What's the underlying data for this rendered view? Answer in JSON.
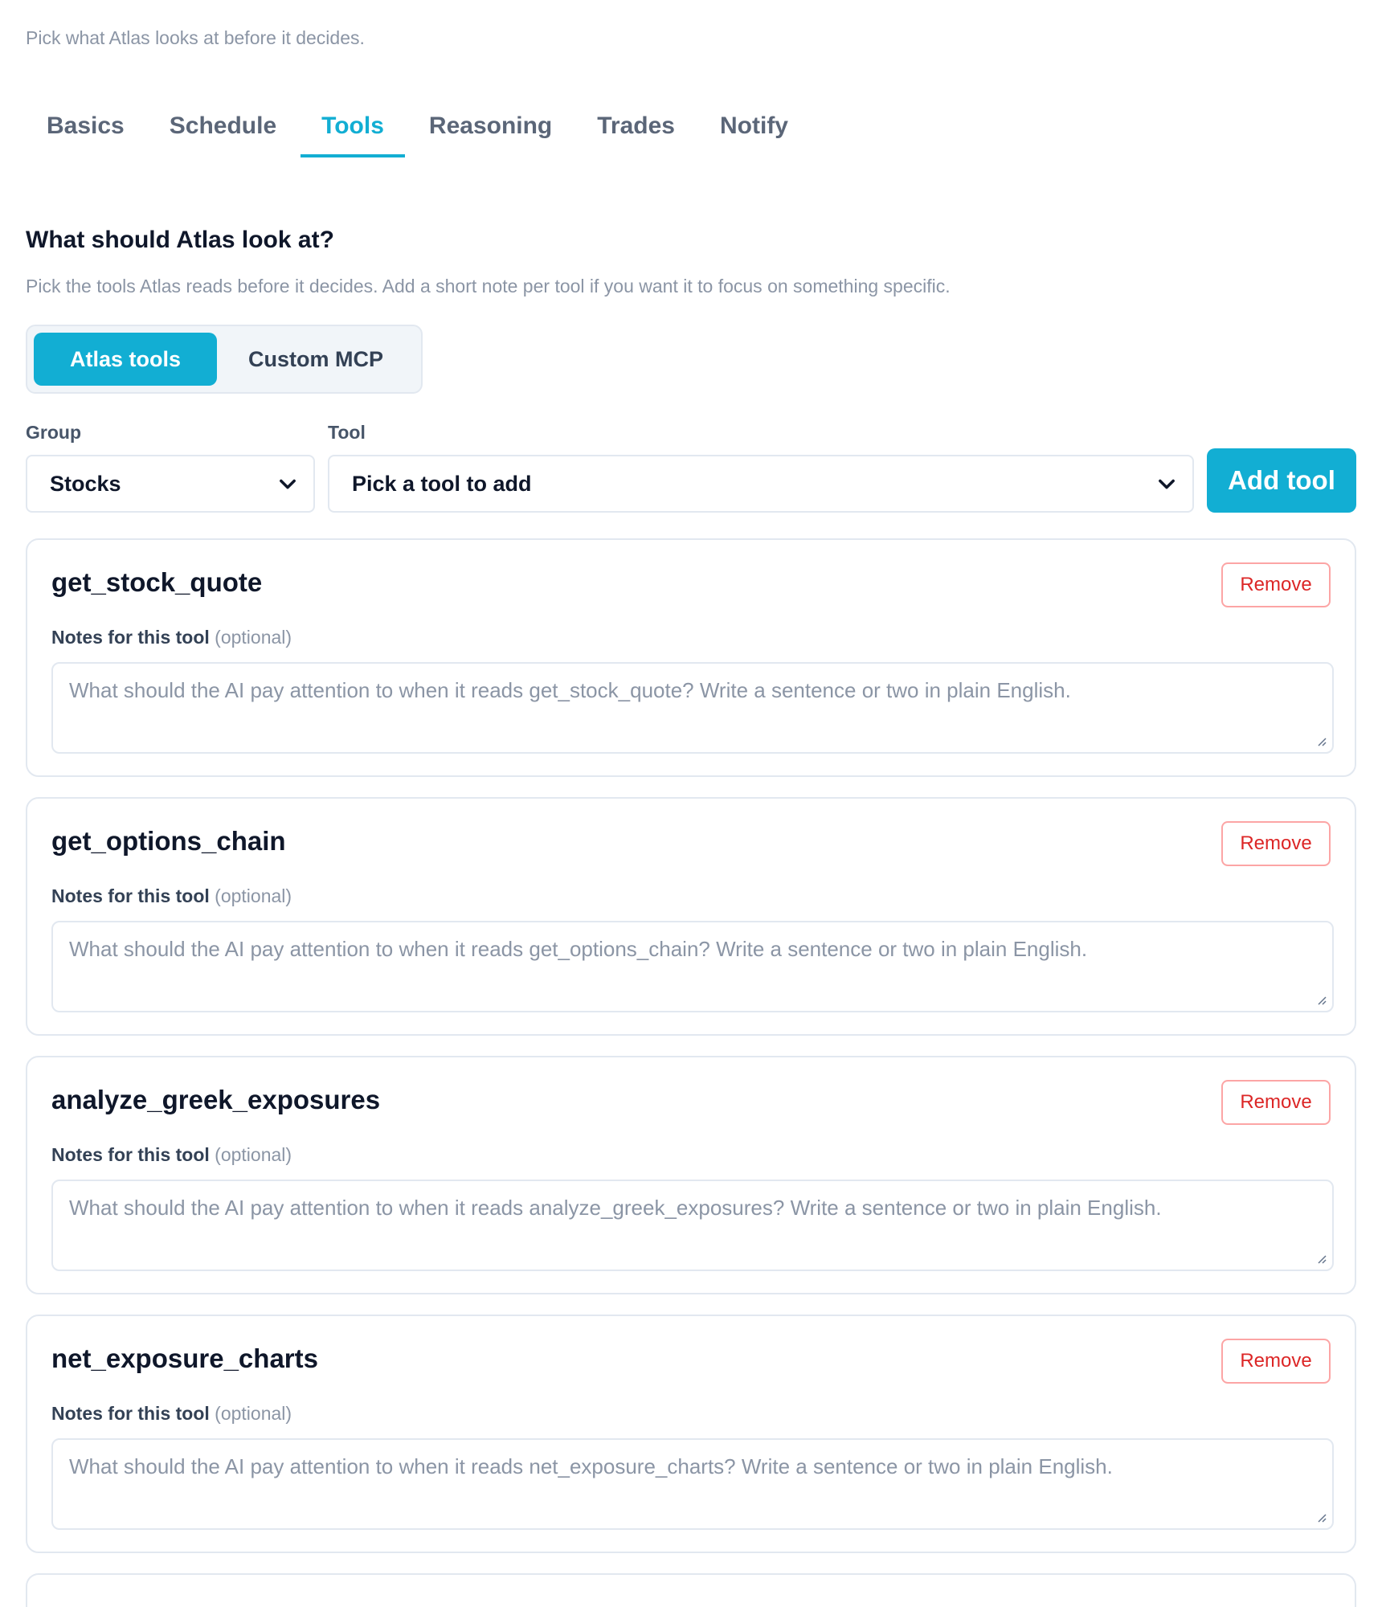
{
  "header": {
    "subtitle": "Pick what Atlas looks at before it decides."
  },
  "tabs": [
    {
      "label": "Basics",
      "active": false
    },
    {
      "label": "Schedule",
      "active": false
    },
    {
      "label": "Tools",
      "active": true
    },
    {
      "label": "Reasoning",
      "active": false
    },
    {
      "label": "Trades",
      "active": false
    },
    {
      "label": "Notify",
      "active": false
    }
  ],
  "section": {
    "title": "What should Atlas look at?",
    "description": "Pick the tools Atlas reads before it decides. Add a short note per tool if you want it to focus on something specific."
  },
  "source_toggle": {
    "options": [
      "Atlas tools",
      "Custom MCP"
    ],
    "selected": "Atlas tools"
  },
  "picker": {
    "group_label": "Group",
    "group_value": "Stocks",
    "tool_label": "Tool",
    "tool_value": "Pick a tool to add",
    "add_label": "Add tool"
  },
  "tools": [
    {
      "name": "get_stock_quote",
      "remove_label": "Remove",
      "notes_label": "Notes for this tool",
      "notes_optional": "(optional)",
      "notes_placeholder": "What should the AI pay attention to when it reads get_stock_quote? Write a sentence or two in plain English."
    },
    {
      "name": "get_options_chain",
      "remove_label": "Remove",
      "notes_label": "Notes for this tool",
      "notes_optional": "(optional)",
      "notes_placeholder": "What should the AI pay attention to when it reads get_options_chain? Write a sentence or two in plain English."
    },
    {
      "name": "analyze_greek_exposures",
      "remove_label": "Remove",
      "notes_label": "Notes for this tool",
      "notes_optional": "(optional)",
      "notes_placeholder": "What should the AI pay attention to when it reads analyze_greek_exposures? Write a sentence or two in plain English."
    },
    {
      "name": "net_exposure_charts",
      "remove_label": "Remove",
      "notes_label": "Notes for this tool",
      "notes_optional": "(optional)",
      "notes_placeholder": "What should the AI pay attention to when it reads net_exposure_charts? Write a sentence or two in plain English."
    }
  ],
  "colors": {
    "accent": "#12aed3",
    "danger": "#dc2626",
    "muted": "#8b95a5"
  }
}
